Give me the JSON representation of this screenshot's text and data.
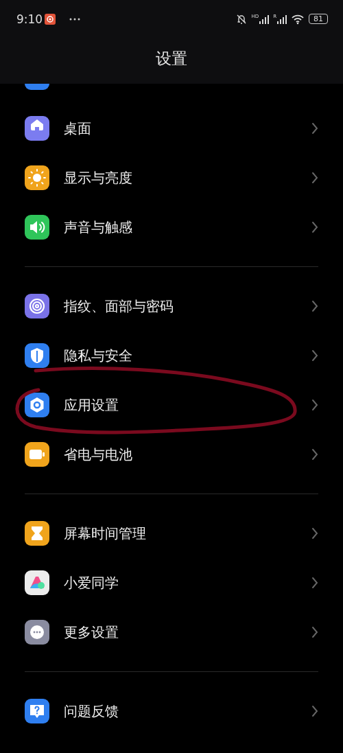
{
  "status_bar": {
    "time": "9:10",
    "sim_labels": [
      "HD",
      "R"
    ],
    "battery": "81"
  },
  "title": "设置",
  "groups": [
    {
      "items": [
        {
          "label": "桌面",
          "color": "#7b7cf0",
          "circled": false
        },
        {
          "label": "显示与亮度",
          "color": "#f0a41c",
          "circled": false
        },
        {
          "label": "声音与触感",
          "color": "#2fc55a",
          "circled": false
        }
      ]
    },
    {
      "items": [
        {
          "label": "指纹、面部与密码",
          "color": "#7a72e8",
          "circled": false
        },
        {
          "label": "隐私与安全",
          "color": "#2f7ff0",
          "circled": false
        },
        {
          "label": "应用设置",
          "color": "#2f7ff0",
          "circled": true
        },
        {
          "label": "省电与电池",
          "color": "#f0a41c",
          "circled": false
        }
      ]
    },
    {
      "items": [
        {
          "label": "屏幕时间管理",
          "color": "#f0a41c",
          "circled": false
        },
        {
          "label": "小爱同学",
          "color": "#ececec",
          "circled": false
        },
        {
          "label": "更多设置",
          "color": "#8a8ca0",
          "circled": false
        }
      ]
    },
    {
      "items": [
        {
          "label": "问题反馈",
          "color": "#2f7ff0",
          "circled": false
        }
      ]
    }
  ]
}
